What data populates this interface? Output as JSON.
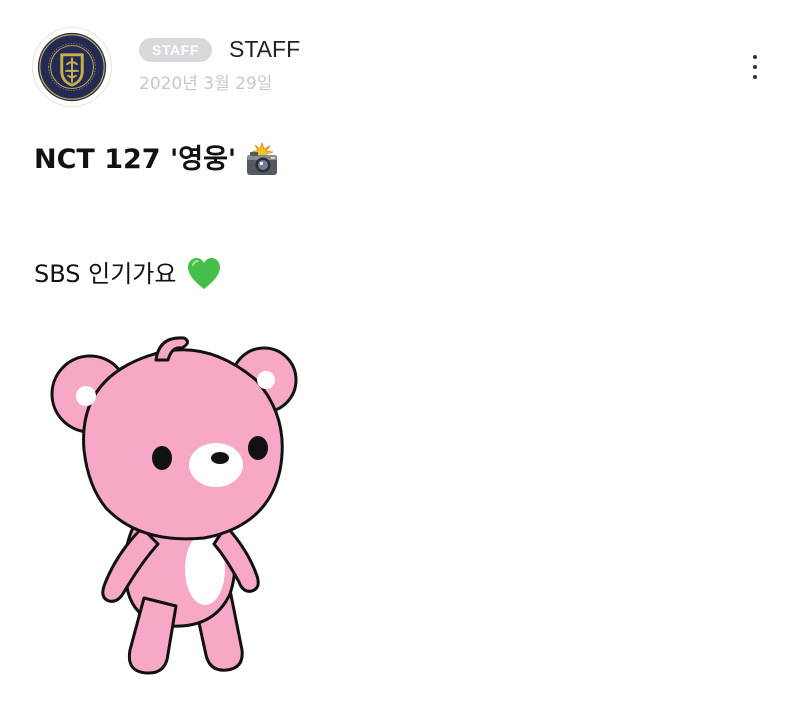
{
  "header": {
    "badge": "STAFF",
    "author": "STAFF",
    "date": "2020년 3월 29일"
  },
  "post": {
    "title": "NCT 127 '영웅'",
    "title_icon": "camera-with-flash-icon",
    "body": "SBS 인기가요",
    "body_icon": "green-heart-icon",
    "sticker": "pink-bear-sticker"
  },
  "icons": {
    "avatar": "nct-127-emblem-avatar",
    "more": "more-vertical-icon"
  },
  "colors": {
    "badge_bg": "#d9d9dd",
    "date_text": "#c8c8cc",
    "bear_pink": "#f7a8c6",
    "heart_green": "#44c04a",
    "emblem_navy": "#232b55",
    "emblem_gold": "#c9b04a"
  }
}
